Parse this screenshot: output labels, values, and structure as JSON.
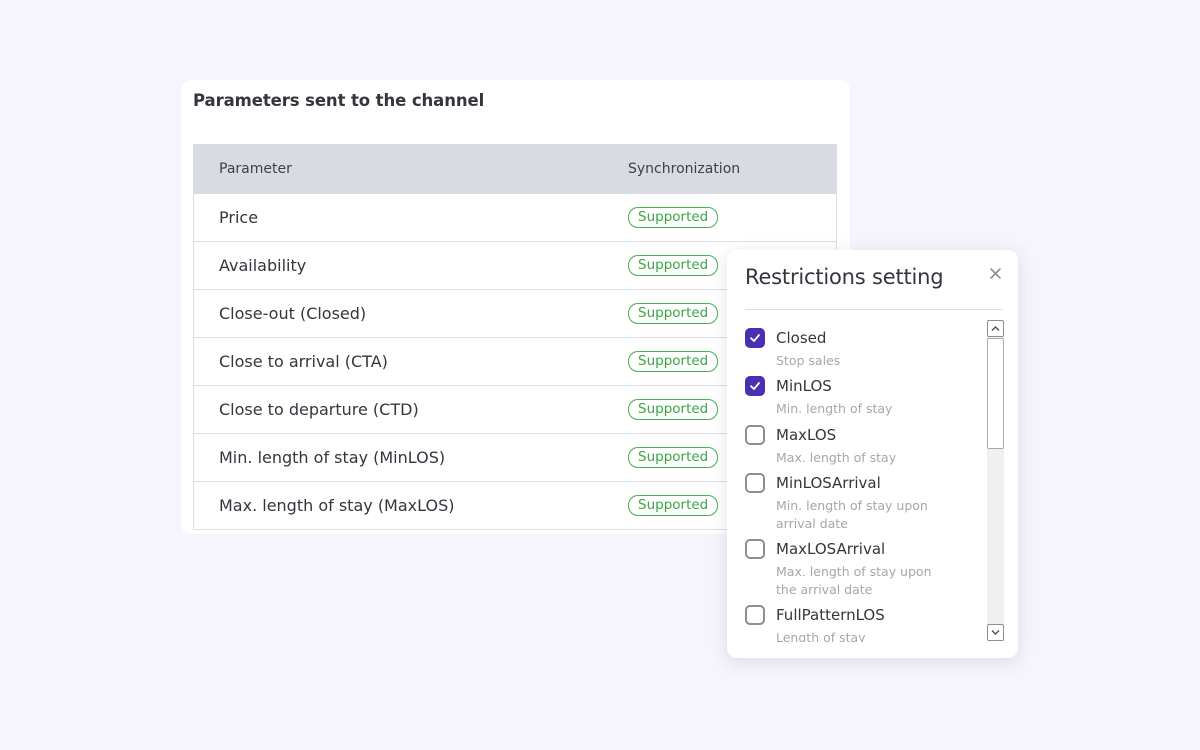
{
  "params": {
    "title": "Parameters sent to the channel",
    "columns": {
      "parameter": "Parameter",
      "sync": "Synchronization"
    },
    "rows": [
      {
        "label": "Price",
        "status": "Supported"
      },
      {
        "label": "Availability",
        "status": "Supported"
      },
      {
        "label": "Close-out (Closed)",
        "status": "Supported"
      },
      {
        "label": "Close to arrival (CTA)",
        "status": "Supported"
      },
      {
        "label": "Close to departure (CTD)",
        "status": "Supported"
      },
      {
        "label": "Min. length of stay (MinLOS)",
        "status": "Supported"
      },
      {
        "label": "Max. length of stay (MaxLOS)",
        "status": "Supported"
      }
    ]
  },
  "popup": {
    "title": "Restrictions setting",
    "close_icon": "close-icon",
    "items": [
      {
        "name": "Closed",
        "description": "Stop sales",
        "checked": true
      },
      {
        "name": "MinLOS",
        "description": "Min. length of stay",
        "checked": true
      },
      {
        "name": "MaxLOS",
        "description": "Max. length of stay",
        "checked": false
      },
      {
        "name": "MinLOSArrival",
        "description": "Min. length of stay upon arrival date",
        "checked": false
      },
      {
        "name": "MaxLOSArrival",
        "description": "Max. length of stay upon the arrival date",
        "checked": false
      },
      {
        "name": "FullPatternLOS",
        "description": "Length of stay",
        "checked": false
      }
    ]
  },
  "colors": {
    "background": "#f6f5fd",
    "accent": "#4b2fb3",
    "supported": "#3aa745",
    "table_header": "#d8dce2"
  }
}
